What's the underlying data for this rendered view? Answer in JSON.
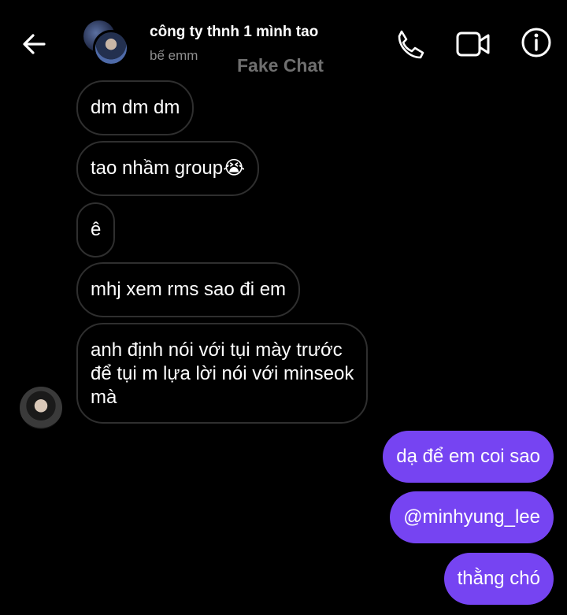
{
  "header": {
    "title": "công ty thnh 1 mình tao",
    "subtitle": "bế emm",
    "watermark": "Fake Chat",
    "icons": [
      "arrow-left-icon",
      "phone-icon",
      "video-camera-icon",
      "info-icon"
    ]
  },
  "messages": {
    "incoming": [
      {
        "text": "dm dm dm"
      },
      {
        "text": "tao nhầm group😭"
      },
      {
        "text": "ê"
      },
      {
        "text": "mhj xem rms sao đi em"
      },
      {
        "lines": [
          "anh định nói với tụi mày trước",
          "để tụi m lựa lời nói với minseok",
          "mà"
        ]
      }
    ],
    "outgoing": [
      {
        "text": "dạ để em coi sao"
      },
      {
        "text": "@minhyung_lee"
      },
      {
        "text": "thằng chó"
      }
    ]
  },
  "colors": {
    "background": "#000000",
    "outgoing_bubble": "#7644f2",
    "incoming_border": "#2f2f2f",
    "subtitle": "#8e8e8e",
    "watermark": "#6f6f6f"
  }
}
